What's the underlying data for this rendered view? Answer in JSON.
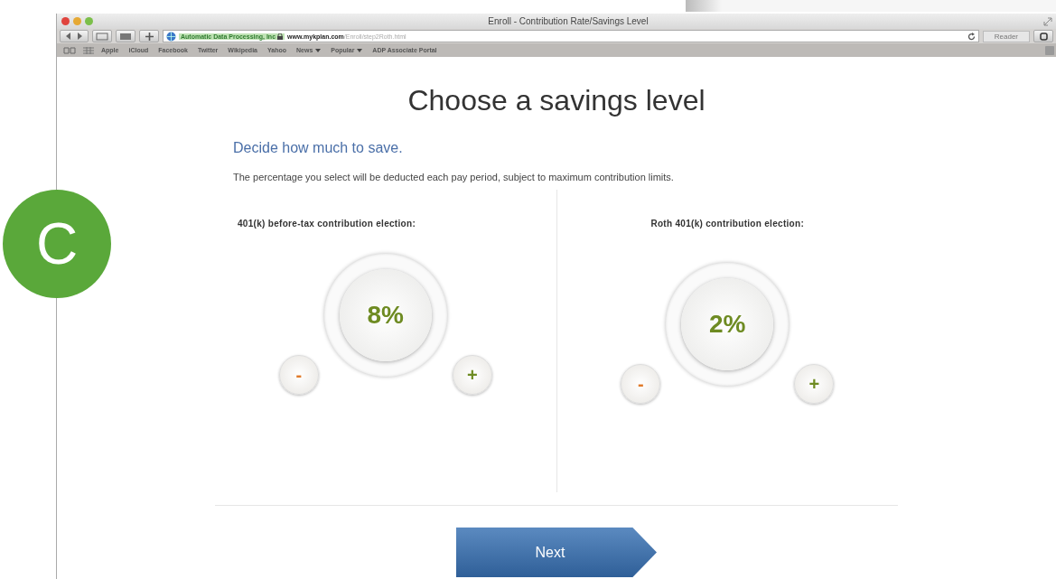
{
  "window": {
    "title": "Enroll - Contribution Rate/Savings Level"
  },
  "toolbar": {
    "site_identity": "Automatic Data Processing, Inc",
    "url_domain": "www.mykplan.com",
    "url_path": "/Enroll/step2Roth.html",
    "reader": "Reader"
  },
  "bookmarks": [
    {
      "label": "Apple",
      "kind": "link"
    },
    {
      "label": "iCloud",
      "kind": "link"
    },
    {
      "label": "Facebook",
      "kind": "link"
    },
    {
      "label": "Twitter",
      "kind": "link"
    },
    {
      "label": "Wikipedia",
      "kind": "link"
    },
    {
      "label": "Yahoo",
      "kind": "link"
    },
    {
      "label": "News",
      "kind": "menu"
    },
    {
      "label": "Popular",
      "kind": "menu"
    },
    {
      "label": "ADP Associate Portal",
      "kind": "link"
    }
  ],
  "page": {
    "heading": "Choose a savings level",
    "subheading": "Decide how much to save.",
    "description": "The percentage you select will be deducted each pay period, subject to maximum contribution limits.",
    "elections": [
      {
        "label": "401(k) before-tax contribution election:",
        "value": "8%",
        "minus": "-",
        "plus": "+"
      },
      {
        "label": "Roth 401(k) contribution election:",
        "value": "2%",
        "minus": "-",
        "plus": "+"
      }
    ],
    "next": "Next"
  },
  "step_badge": "C"
}
